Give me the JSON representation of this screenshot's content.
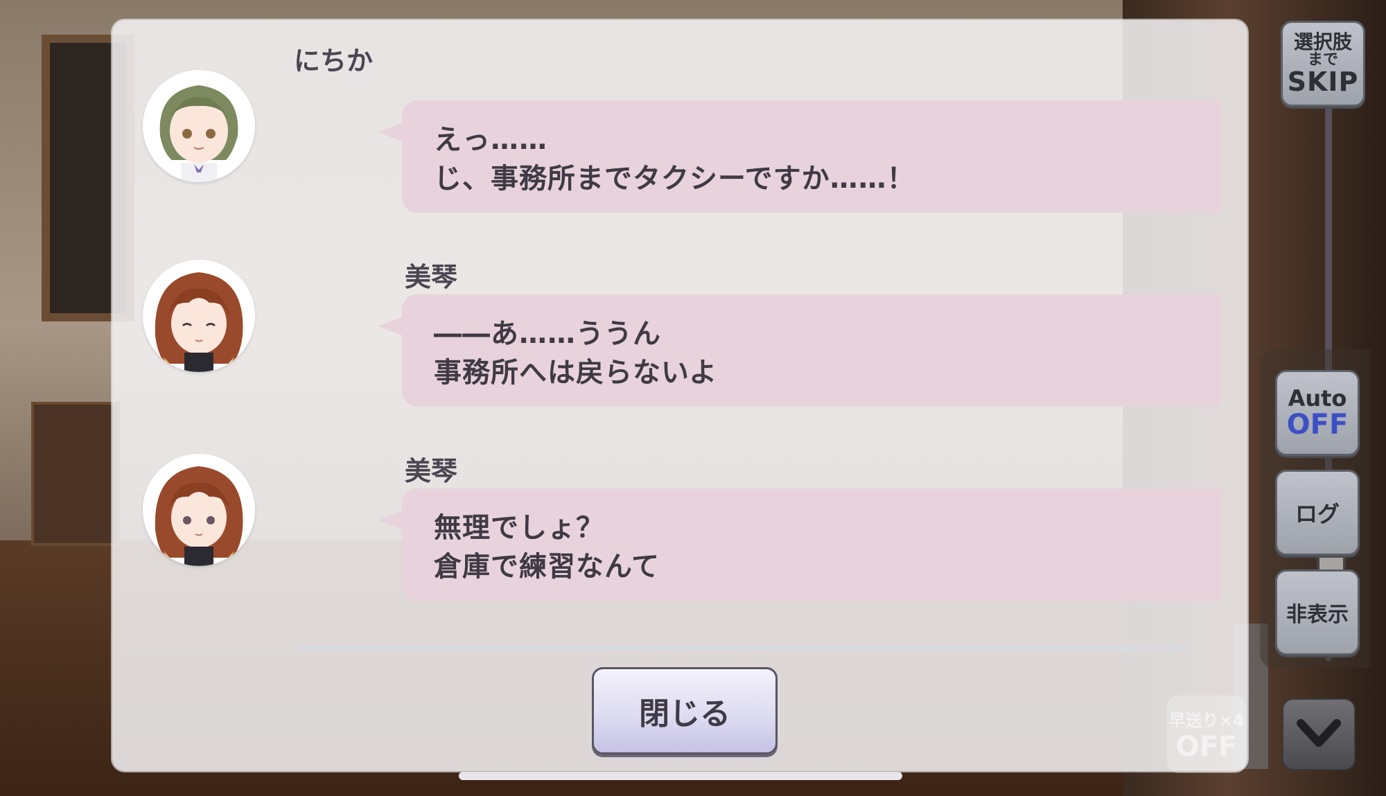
{
  "log": {
    "entries": [
      {
        "speaker": "にちか",
        "lines": [
          "えっ……",
          "じ、事務所までタクシーですか……！"
        ],
        "avatar": "nichika-avatar"
      },
      {
        "speaker": "美琴",
        "lines": [
          "――あ……ううん",
          "事務所へは戻らないよ"
        ],
        "avatar": "mikoto-avatar"
      },
      {
        "speaker": "美琴",
        "lines": [
          "無理でしょ？",
          "倉庫で練習なんて"
        ],
        "avatar": "mikoto-avatar"
      }
    ],
    "scroll_position": 0.85,
    "close_label": "閉じる",
    "voice_icon": "speaker-icon"
  },
  "side_controls": {
    "skip": {
      "line1": "選択肢",
      "line2": "まで",
      "line3": "SKIP"
    },
    "auto": {
      "label": "Auto",
      "state": "OFF"
    },
    "log_label": "ログ",
    "hide_label": "非表示",
    "fast_forward": {
      "label": "早送り×4",
      "state": "OFF"
    },
    "down_icon": "chevron-down-icon"
  },
  "colors": {
    "bubble": "#e8d3dd",
    "auto_off": "#3c4fc6"
  }
}
